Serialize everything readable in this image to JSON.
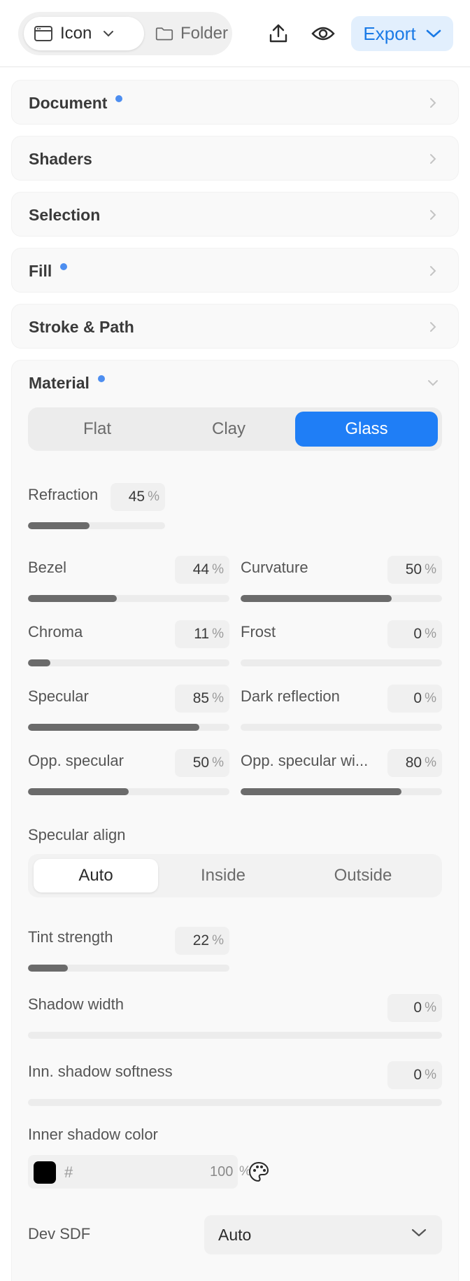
{
  "toolbar": {
    "mode_icon_label": "Icon",
    "mode_folder_label": "Folder",
    "export_label": "Export"
  },
  "panels": [
    {
      "title": "Document",
      "dot": true
    },
    {
      "title": "Shaders",
      "dot": false
    },
    {
      "title": "Selection",
      "dot": false
    },
    {
      "title": "Fill",
      "dot": true
    },
    {
      "title": "Stroke & Path",
      "dot": false
    },
    {
      "title": "Material",
      "dot": true
    }
  ],
  "material": {
    "modes": [
      "Flat",
      "Clay",
      "Glass"
    ],
    "active_mode": "Glass",
    "unit": "%",
    "refraction": {
      "label": "Refraction",
      "value": 45
    },
    "bezel": {
      "label": "Bezel",
      "value": 44
    },
    "curvature": {
      "label": "Curvature",
      "value": 50
    },
    "chroma": {
      "label": "Chroma",
      "value": 11
    },
    "frost": {
      "label": "Frost",
      "value": 0
    },
    "specular": {
      "label": "Specular",
      "value": 85
    },
    "dark_reflection": {
      "label": "Dark reflection",
      "value": 0
    },
    "opp_specular": {
      "label": "Opp. specular",
      "value": 50
    },
    "opp_specular_width": {
      "label": "Opp. specular wi...",
      "value": 80
    },
    "specular_align": {
      "label": "Specular align",
      "options": [
        "Auto",
        "Inside",
        "Outside"
      ],
      "selected": "Auto"
    },
    "tint_strength": {
      "label": "Tint strength",
      "value": 22
    },
    "shadow_width": {
      "label": "Shadow width",
      "value": 0
    },
    "inner_shadow_softness": {
      "label": "Inn. shadow softness",
      "value": 0
    },
    "inner_shadow_color": {
      "label": "Inner shadow color",
      "hash": "#",
      "hex_value": "",
      "color": "#000000",
      "alpha": "100",
      "alpha_unit": "%"
    },
    "dev_sdf": {
      "label": "Dev SDF",
      "value": "Auto"
    }
  },
  "colors": {
    "accent": "#1f7ef6",
    "dot": "#4d8ef0",
    "slider_fill": "#6b6b6b"
  }
}
